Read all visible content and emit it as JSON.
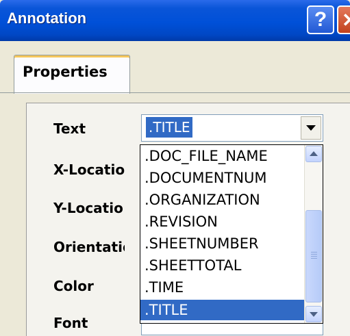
{
  "window": {
    "title": "Annotation"
  },
  "tabs": [
    {
      "label": "Properties"
    }
  ],
  "form": {
    "labels": [
      "Text",
      "X-Locatio",
      "Y-Locatio",
      "Orientatic",
      "Color",
      "Font"
    ],
    "text_combo": {
      "value": ".TITLE"
    }
  },
  "dropdown": {
    "options": [
      ".DOC_FILE_NAME",
      ".DOCUMENTNUM",
      ".ORGANIZATION",
      ".REVISION",
      ".SHEETNUMBER",
      ".SHEETTOTAL",
      ".TIME",
      ".TITLE"
    ],
    "selected": ".TITLE"
  },
  "colors": {
    "titlebar": "#0050d8",
    "selection": "#316ac5",
    "dialog_bg": "#ece9d8"
  }
}
